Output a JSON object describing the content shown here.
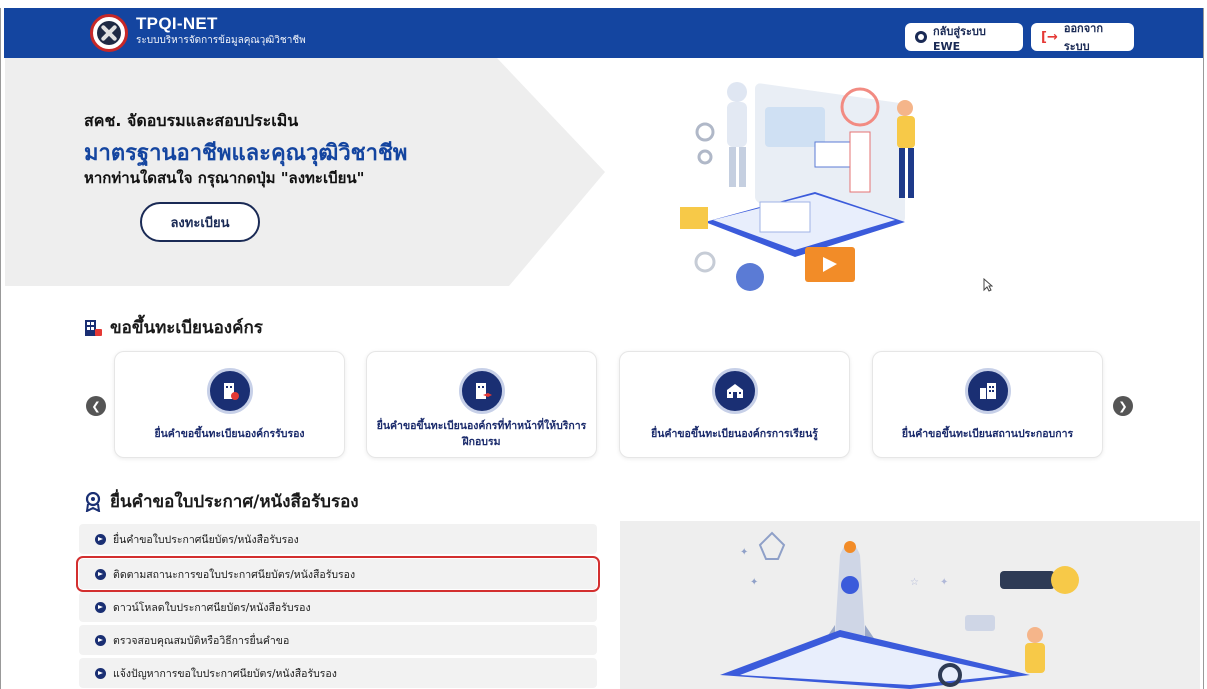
{
  "header": {
    "brand_title": "TPQI-NET",
    "brand_subtitle": "ระบบบริหารจัดการข้อมูลคุณวุฒิวิชาชีพ",
    "back_button": "กลับสู่ระบบ EWE",
    "logout_button": "ออกจากระบบ",
    "bg_color": "#1445a0"
  },
  "hero": {
    "line1": "สคช. จัดอบรมและสอบประเมิน",
    "line2": "มาตรฐานอาชีพและคุณวุฒิวิชาชีพ",
    "line3": "หากท่านใดสนใจ กรุณากดปุ่ม \"ลงทะเบียน\"",
    "register_button": "ลงทะเบียน"
  },
  "org_section": {
    "title": "ขอขึ้นทะเบียนองค์กร",
    "cards": [
      {
        "label": "ยื่นคำขอขึ้นทะเบียนองค์กรรับรอง",
        "icon": "building-gear-icon"
      },
      {
        "label": "ยื่นคำขอขึ้นทะเบียนองค์กรที่ทำหน้าที่ให้บริการฝึกอบรม",
        "icon": "building-graduation-icon"
      },
      {
        "label": "ยื่นคำขอขึ้นทะเบียนองค์กรการเรียนรู้",
        "icon": "school-icon"
      },
      {
        "label": "ยื่นคำขอขึ้นทะเบียนสถานประกอบการ",
        "icon": "city-icon"
      }
    ]
  },
  "cert_section": {
    "title": "ยื่นคำขอใบประกาศ/หนังสือรับรอง",
    "items": [
      {
        "label": "ยื่นคำขอใบประกาศนียบัตร/หนังสือรับรอง",
        "highlighted": false
      },
      {
        "label": "ติดตามสถานะการขอใบประกาศนียบัตร/หนังสือรับรอง",
        "highlighted": true
      },
      {
        "label": "ดาวน์โหลดใบประกาศนียบัตร/หนังสือรับรอง",
        "highlighted": false
      },
      {
        "label": "ตรวจสอบคุณสมบัติหรือวิธีการยื่นคำขอ",
        "highlighted": false
      },
      {
        "label": "แจ้งปัญหาการขอใบประกาศนียบัตร/หนังสือรับรอง",
        "highlighted": false
      }
    ]
  },
  "colors": {
    "primary": "#1445a0",
    "card_icon": "#1a2f73",
    "highlight": "#d32f2f"
  }
}
